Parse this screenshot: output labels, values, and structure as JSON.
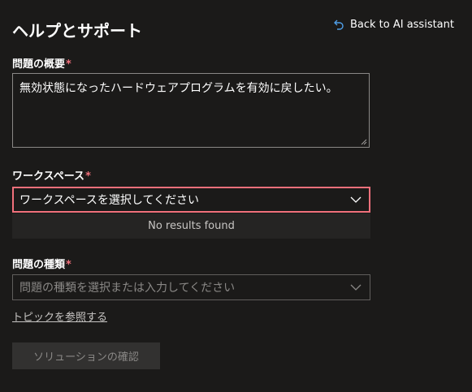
{
  "header": {
    "title": "ヘルプとサポート",
    "back_label": "Back to AI assistant"
  },
  "summary": {
    "label": "問題の概要",
    "required_mark": "*",
    "value": "無効状態になったハードウェアプログラムを有効に戻したい。"
  },
  "workspace": {
    "label": "ワークスペース",
    "required_mark": "*",
    "placeholder": "ワークスペースを選択してください",
    "no_results": "No results found"
  },
  "problem_type": {
    "label": "問題の種類",
    "required_mark": "*",
    "placeholder": "問題の種類を選択または入力してください"
  },
  "topic_link": "トピックを参照する",
  "confirm_button": "ソリューションの確認",
  "colors": {
    "background": "#1b1a19",
    "accent_link": "#4f9fe8",
    "error_border": "#f1707b"
  }
}
